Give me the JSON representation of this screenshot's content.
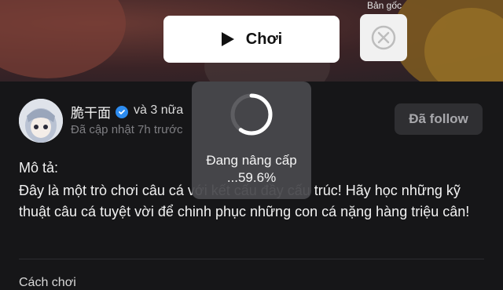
{
  "banner": {
    "play_label": "Chơi",
    "original_label": "Bản gốc",
    "icons": {
      "play": "play-icon",
      "original": "close-circle-icon"
    }
  },
  "post": {
    "author": "脆干面",
    "others": "và 3 nữa",
    "updated": "Đã cập nhật 7h trước",
    "follow_label": "Đã follow",
    "verified_color": "#2d8cf0",
    "description_title": "Mô tả:",
    "description_text": "Đây là một trò chơi câu cá với kết cấu đầy cấu trúc! Hãy học những kỹ thuật câu cá tuyệt vời để chinh phục những con cá nặng hàng triệu cân!",
    "next_section": "Cách chơi"
  },
  "loading": {
    "label": "Đang nâng cấp ...59.6%",
    "progress": 0.596
  }
}
